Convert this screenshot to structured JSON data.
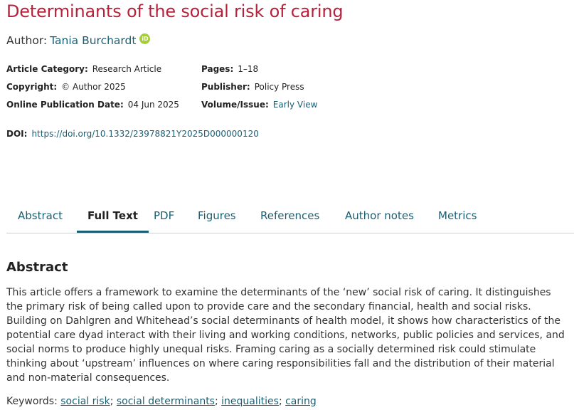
{
  "article": {
    "title": "Determinants of the social risk of caring",
    "author_label": "Author:",
    "author_name": "Tania Burchardt",
    "orcid_badge": "iD"
  },
  "meta": {
    "category_label": "Article Category:",
    "category_value": "Research Article",
    "copyright_label": "Copyright:",
    "copyright_value": "© Author 2025",
    "online_date_label": "Online Publication Date:",
    "online_date_value": "04 Jun 2025",
    "pages_label": "Pages:",
    "pages_value": "1–18",
    "publisher_label": "Publisher:",
    "publisher_value": "Policy Press",
    "volume_label": "Volume/Issue:",
    "volume_value": "Early View",
    "doi_label": "DOI:",
    "doi_value": "https://doi.org/10.1332/23978821Y2025D000000120"
  },
  "tabs": {
    "abstract": "Abstract",
    "full_text": "Full Text",
    "pdf": "PDF",
    "figures": "Figures",
    "references": "References",
    "author_notes": "Author notes",
    "metrics": "Metrics"
  },
  "abstract": {
    "heading": "Abstract",
    "text": "This article offers a framework to examine the determinants of the ‘new’ social risk of caring. It distinguishes the primary risk of being called upon to provide care and the secondary financial, health and social risks. Building on Dahlgren and Whitehead’s social determinants of health model, it shows how characteristics of the potential care dyad interact with their living and working conditions, networks, public policies and services, and social norms to produce highly unequal risks. Framing caring as a socially determined risk could stimulate thinking about ‘upstream’ influences on where caring responsibilities fall and the distribution of their material and non-material consequences."
  },
  "keywords": {
    "label": "Keywords:",
    "items": [
      "social risk",
      "social determinants",
      "inequalities",
      "caring"
    ],
    "separator": ";"
  },
  "colors": {
    "title": "#b5223a",
    "link": "#1a5e73",
    "orcid": "#a6ce39"
  }
}
